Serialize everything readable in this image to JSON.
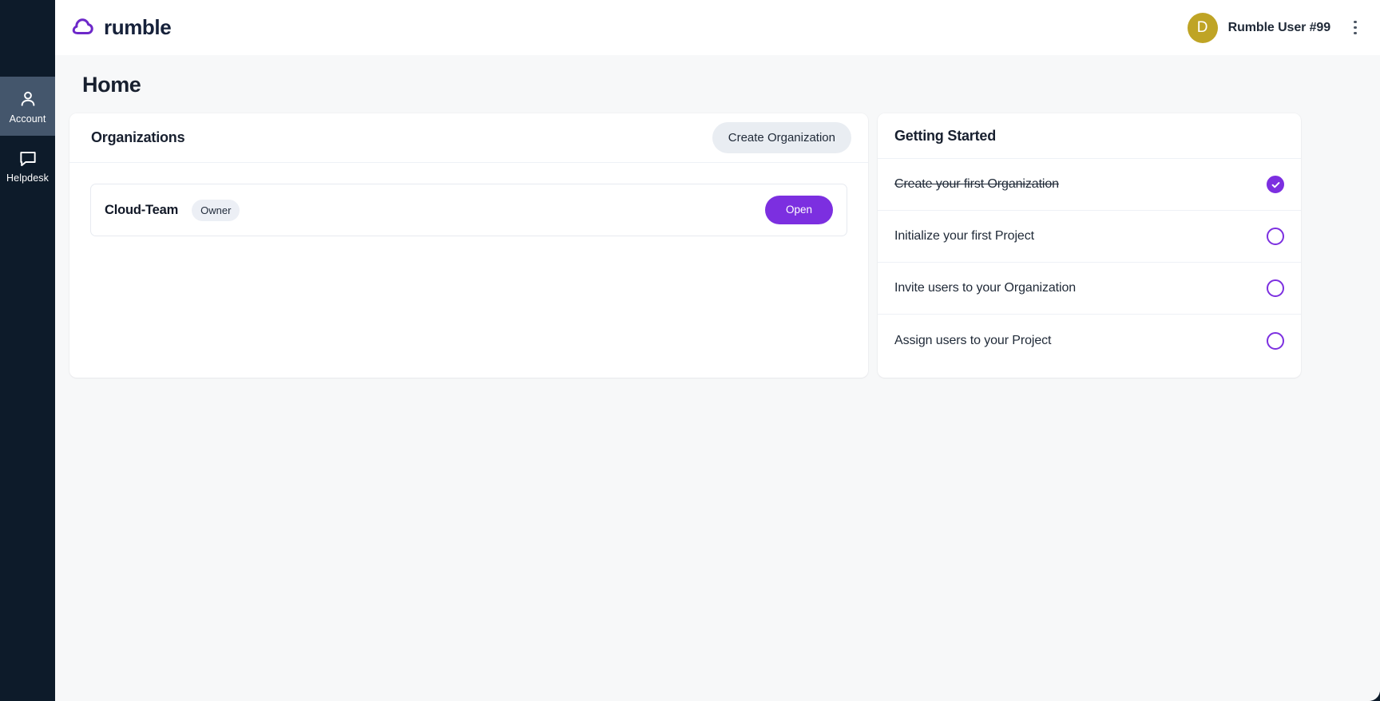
{
  "brand": {
    "name": "rumble",
    "logo_icon": "cloud-logo-icon",
    "accent": "#7c2fe0",
    "wordmark_color": "#16213a"
  },
  "sidebar": {
    "items": [
      {
        "label": "Account",
        "icon": "person-icon",
        "active": true
      },
      {
        "label": "Helpdesk",
        "icon": "chat-bubble-icon",
        "active": false
      }
    ]
  },
  "topbar": {
    "user_name": "Rumble User #99",
    "avatar_initial": "D",
    "avatar_color": "#bfa425",
    "menu_icon": "kebab-menu-icon"
  },
  "page": {
    "title": "Home",
    "background": "#f7f8f9"
  },
  "organizations": {
    "title": "Organizations",
    "create_button": "Create Organization",
    "rows": [
      {
        "name": "Cloud-Team",
        "role": "Owner",
        "action_label": "Open"
      }
    ]
  },
  "getting_started": {
    "title": "Getting Started",
    "items": [
      {
        "label": "Create your first Organization",
        "done": true
      },
      {
        "label": "Initialize your first Project",
        "done": false
      },
      {
        "label": "Invite users to your Organization",
        "done": false
      },
      {
        "label": "Assign users to your Project",
        "done": false
      }
    ]
  }
}
